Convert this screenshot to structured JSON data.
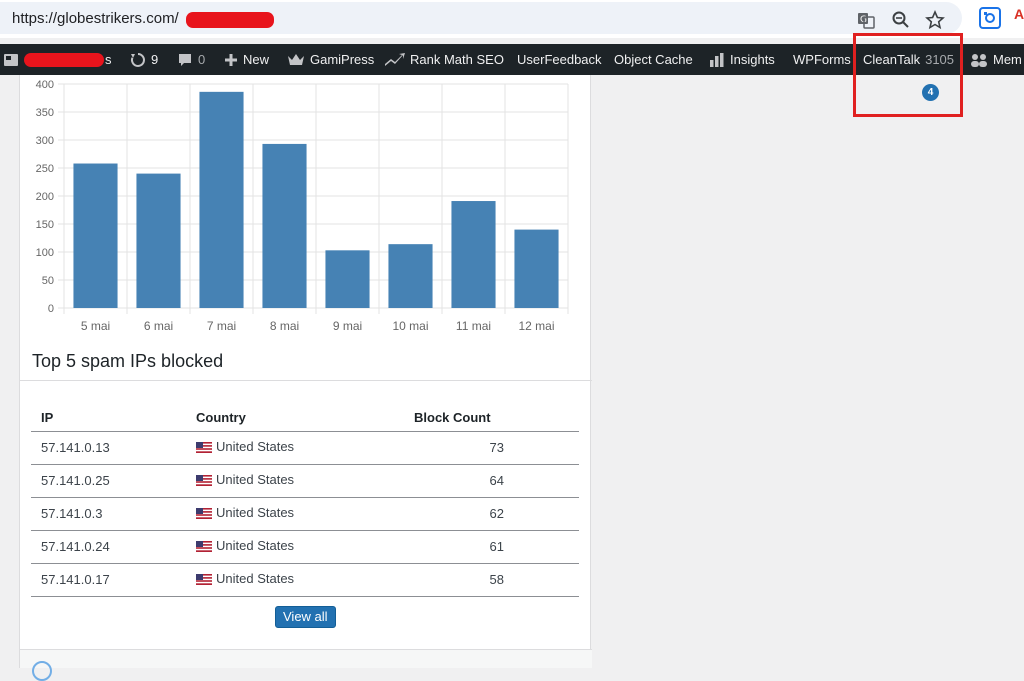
{
  "browser": {
    "url": "https://globestrikers.com/"
  },
  "adminbar": {
    "updates_count": "9",
    "comments_count": "0",
    "new_label": "New",
    "gamipress_label": "GamiPress",
    "rankmath_label": "Rank Math SEO",
    "userfeedback_label": "UserFeedback",
    "objectcache_label": "Object Cache",
    "insights_label": "Insights",
    "wpforms_label": "WPForms",
    "cleantalk_label": "CleanTalk",
    "cleantalk_count": "3105",
    "cleantalk_badge": "4",
    "members_label": "Mem"
  },
  "chart_data": {
    "type": "bar",
    "categories": [
      "5 mai",
      "6 mai",
      "7 mai",
      "8 mai",
      "9 mai",
      "10 mai",
      "11 mai",
      "12 mai"
    ],
    "values": [
      258,
      240,
      386,
      293,
      103,
      114,
      191,
      140
    ],
    "ylim": [
      0,
      400
    ],
    "yticks": [
      0,
      50,
      100,
      150,
      200,
      250,
      300,
      350,
      400
    ],
    "grid": true,
    "bar_color": "#4682b4"
  },
  "spam_section": {
    "title": "Top 5 spam IPs blocked",
    "columns": [
      "IP",
      "Country",
      "Block Count"
    ],
    "rows": [
      {
        "ip": "57.141.0.13",
        "country": "United States",
        "count": "73"
      },
      {
        "ip": "57.141.0.25",
        "country": "United States",
        "count": "64"
      },
      {
        "ip": "57.141.0.3",
        "country": "United States",
        "count": "62"
      },
      {
        "ip": "57.141.0.24",
        "country": "United States",
        "count": "61"
      },
      {
        "ip": "57.141.0.17",
        "country": "United States",
        "count": "58"
      }
    ],
    "view_all_label": "View all"
  },
  "icons": [
    "translate-icon",
    "zoom-icon",
    "star-icon",
    "screenshot-extension-icon",
    "site-icon",
    "updates-icon",
    "comment-icon",
    "plus-icon",
    "crown-icon",
    "rankmath-icon",
    "insights-icon",
    "members-icon",
    "flag-us-icon"
  ],
  "colors": {
    "adminbar_bg": "#1d2327",
    "accent_blue": "#2271b1",
    "highlight_red": "#e02020"
  }
}
